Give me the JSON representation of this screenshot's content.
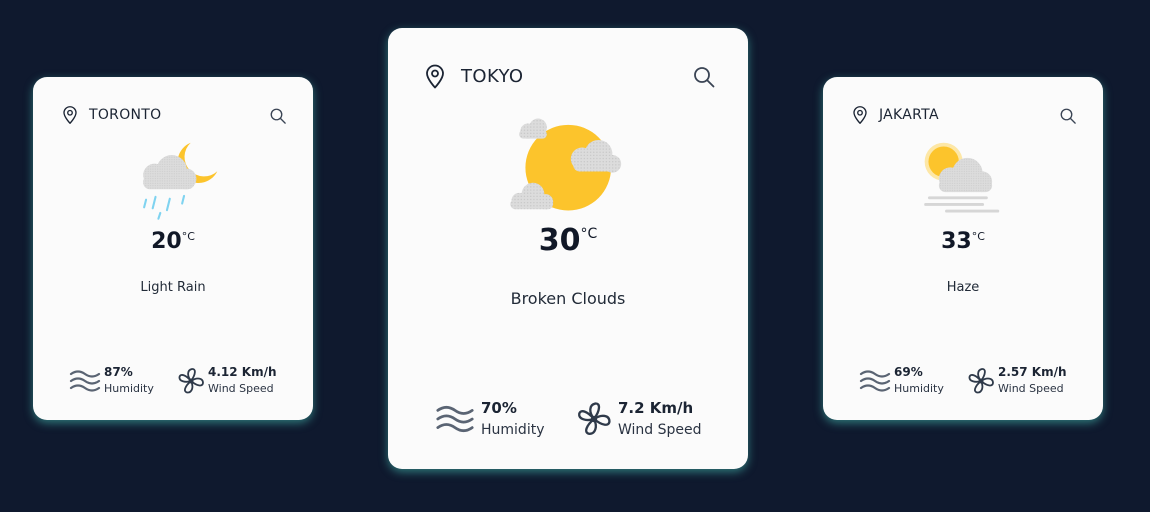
{
  "cards": [
    {
      "city": "TORONTO",
      "temperature": "20",
      "unit": "°C",
      "condition": "Light Rain",
      "icon": "moon-cloud-rain-icon",
      "humidity": {
        "value": "87%",
        "label": "Humidity"
      },
      "wind": {
        "value": "4.12 Km/h",
        "label": "Wind Speed"
      }
    },
    {
      "city": "TOKYO",
      "temperature": "30",
      "unit": "°C",
      "condition": "Broken Clouds",
      "icon": "sun-broken-clouds-icon",
      "humidity": {
        "value": "70%",
        "label": "Humidity"
      },
      "wind": {
        "value": "7.2 Km/h",
        "label": "Wind Speed"
      }
    },
    {
      "city": "JAKARTA",
      "temperature": "33",
      "unit": "°C",
      "condition": "Haze",
      "icon": "sun-cloud-haze-icon",
      "humidity": {
        "value": "69%",
        "label": "Humidity"
      },
      "wind": {
        "value": "2.57 Km/h",
        "label": "Wind Speed"
      }
    }
  ],
  "colors": {
    "background": "#0f192e",
    "card": "#fbfbfb",
    "glow": "#48c4b8",
    "sun": "#fcc42c",
    "cloud": "#d8d8d8",
    "rain": "#7fd3f0",
    "icon_stroke": "#3a4454"
  }
}
